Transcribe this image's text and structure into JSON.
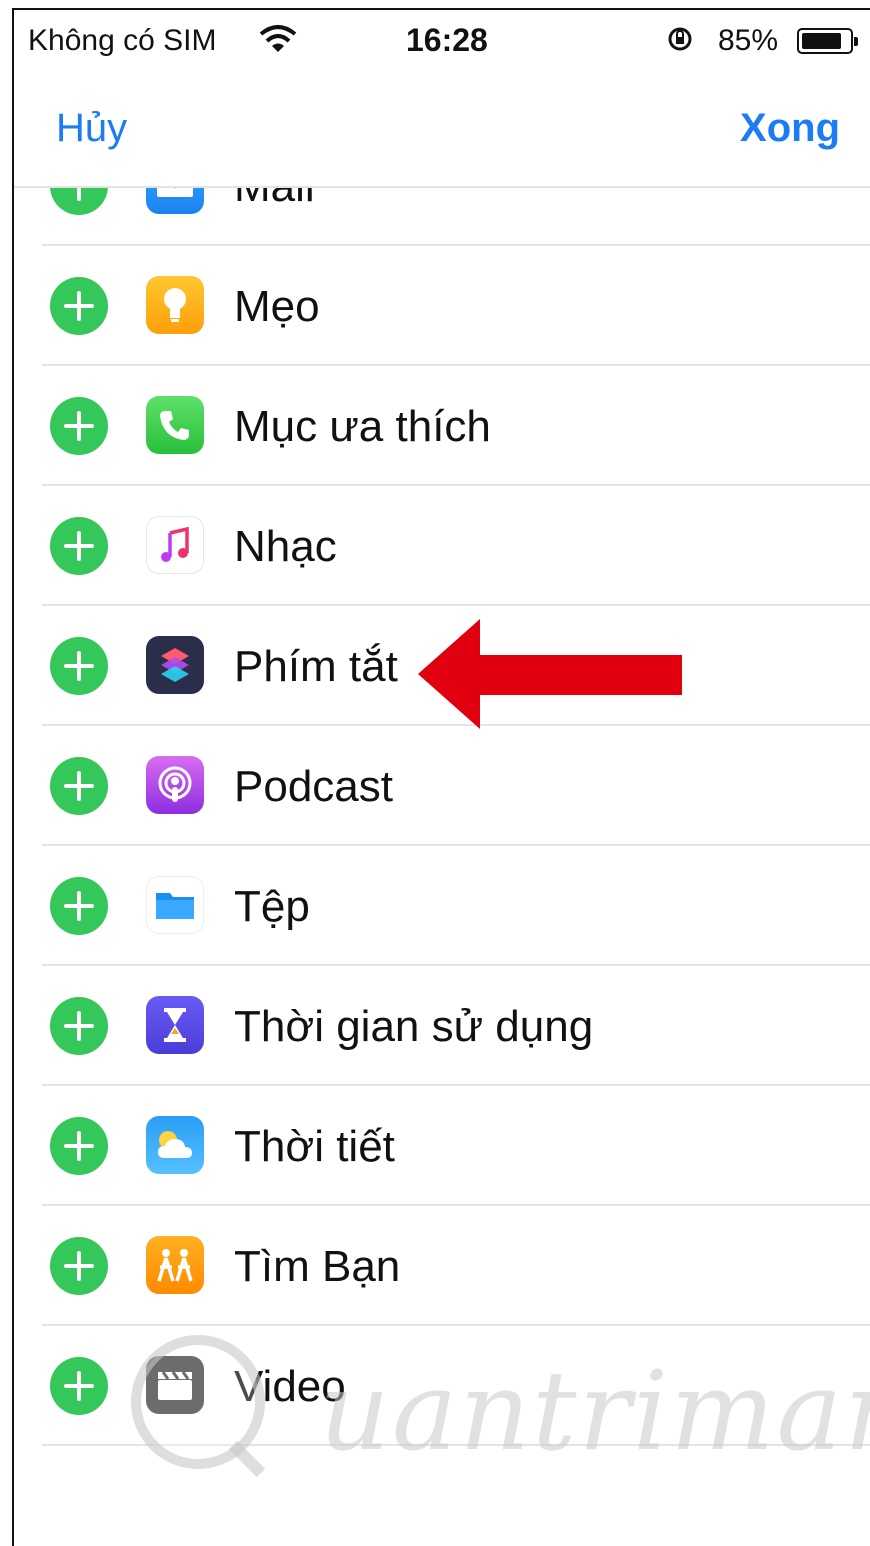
{
  "status_bar": {
    "carrier": "Không có SIM",
    "time": "16:28",
    "battery_percent_text": "85%",
    "battery_level": 0.85
  },
  "nav": {
    "cancel_label": "Hủy",
    "done_label": "Xong",
    "accent_color": "#1b7cf6"
  },
  "apps": [
    {
      "label": "Mail",
      "icon": "mail-icon"
    },
    {
      "label": "Mẹo",
      "icon": "tips-icon"
    },
    {
      "label": "Mục ưa thích",
      "icon": "phone-icon"
    },
    {
      "label": "Nhạc",
      "icon": "music-icon"
    },
    {
      "label": "Phím tắt",
      "icon": "shortcuts-icon"
    },
    {
      "label": "Podcast",
      "icon": "podcast-icon"
    },
    {
      "label": "Tệp",
      "icon": "files-icon"
    },
    {
      "label": "Thời gian sử dụng",
      "icon": "screen-time-icon"
    },
    {
      "label": "Thời tiết",
      "icon": "weather-icon"
    },
    {
      "label": "Tìm Bạn",
      "icon": "find-friends-icon"
    },
    {
      "label": "Video",
      "icon": "video-icon"
    }
  ],
  "annotation": {
    "type": "red-arrow",
    "points_to": "Phím tắt",
    "color": "#e0000f"
  },
  "watermark": {
    "text": "uantrimang"
  },
  "add_button_color": "#34c759"
}
